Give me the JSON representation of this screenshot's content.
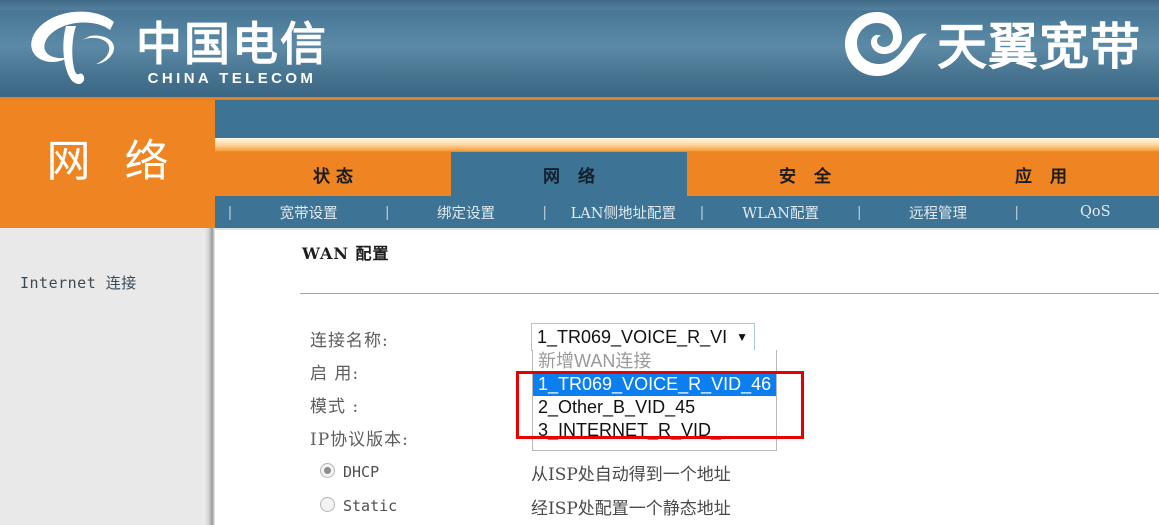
{
  "header": {
    "left_logo": {
      "cn": "中国电信",
      "en": "CHINA TELECOM",
      "icon": "china-telecom-logo-icon"
    },
    "right_logo": {
      "cn": "天翼宽带",
      "icon": "tianyi-swirl-icon"
    }
  },
  "section": {
    "title": "网 络"
  },
  "tabs": [
    {
      "label": "状态",
      "active": false
    },
    {
      "label": "网 络",
      "active": true
    },
    {
      "label": "安 全",
      "active": false
    },
    {
      "label": "应 用",
      "active": false
    }
  ],
  "subnav": [
    {
      "label": "宽带设置"
    },
    {
      "label": "绑定设置"
    },
    {
      "label": "LAN侧地址配置"
    },
    {
      "label": "WLAN配置"
    },
    {
      "label": "远程管理"
    },
    {
      "label": "QoS"
    }
  ],
  "subnav_separator": "|",
  "sidebar": {
    "items": [
      {
        "label": "Internet 连接"
      }
    ]
  },
  "main": {
    "panel_title": "WAN 配置",
    "labels": {
      "connection_name": "连接名称:",
      "enable": "启 用:",
      "mode": "模式 :",
      "ip_version": "IP协议版本:"
    },
    "connection_select": {
      "value": "1_TR069_VOICE_R_VI",
      "arrow": "▼",
      "options": [
        {
          "label": "新增WAN连接",
          "state": "muted"
        },
        {
          "label": "1_TR069_VOICE_R_VID_46",
          "state": "selected"
        },
        {
          "label": "2_Other_B_VID_45",
          "state": "normal"
        },
        {
          "label": "3_INTERNET_R_VID_",
          "state": "normal"
        }
      ]
    },
    "mode_options": [
      {
        "label": "DHCP",
        "checked": true,
        "description": "从ISP处自动得到一个地址"
      },
      {
        "label": "Static",
        "checked": false,
        "description": "经ISP处配置一个静态地址"
      }
    ]
  },
  "colors": {
    "brand_orange": "#ee8422",
    "brand_blue": "#3d7394",
    "highlight_blue": "#0b7ff0",
    "annotation_red": "#e60000"
  }
}
